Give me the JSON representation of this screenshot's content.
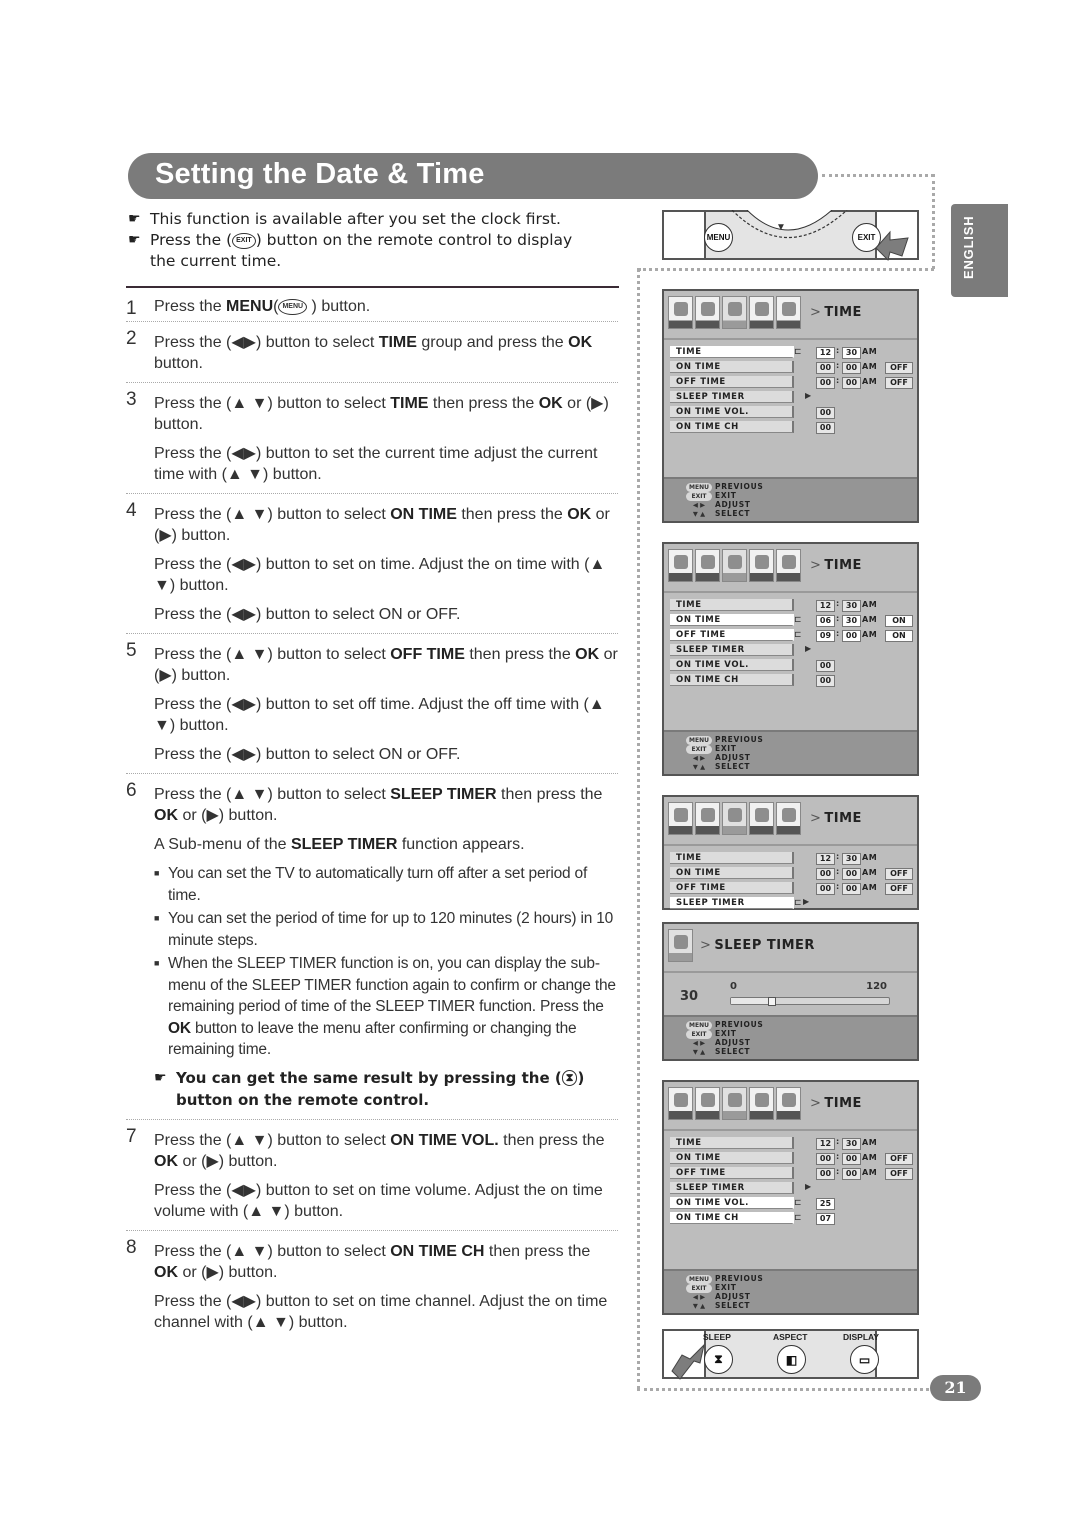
{
  "title": "Setting the Date & Time",
  "side_tab": "ENGLISH",
  "page_number": "21",
  "notes": [
    {
      "text": "This function is available after you set the clock first."
    },
    {
      "prefix": "Press the (",
      "icon": "EXIT",
      "suffix": ") button on the remote control to display",
      "line2": "the current time."
    }
  ],
  "steps": [
    {
      "num": "1",
      "paragraphs": [
        [
          {
            "t": "Press the "
          },
          {
            "b": "MENU"
          },
          {
            "t": "("
          },
          {
            "icon": "MENU"
          },
          {
            "t": " ) button."
          }
        ]
      ]
    },
    {
      "num": "2",
      "paragraphs": [
        [
          {
            "t": "Press the (◀▶) button to select "
          },
          {
            "b": "TIME"
          },
          {
            "t": " group and press the "
          },
          {
            "b": "OK"
          },
          {
            "t": " button."
          }
        ]
      ]
    },
    {
      "num": "3",
      "paragraphs": [
        [
          {
            "t": "Press the (▲ ▼) button to select "
          },
          {
            "b": "TIME"
          },
          {
            "t": " then press the "
          },
          {
            "b": "OK"
          },
          {
            "t": " or (▶) button."
          }
        ],
        [
          {
            "t": "Press the (◀▶) button to set the current time adjust the current time with (▲ ▼) button."
          }
        ]
      ]
    },
    {
      "num": "4",
      "paragraphs": [
        [
          {
            "t": "Press the (▲ ▼) button to select "
          },
          {
            "b": "ON TIME"
          },
          {
            "t": " then press the "
          },
          {
            "b": "OK"
          },
          {
            "t": " or (▶) button."
          }
        ],
        [
          {
            "t": "Press the (◀▶) button to set on time. Adjust the on time with (▲ ▼) button."
          }
        ],
        [
          {
            "t": "Press the (◀▶) button to select ON or OFF."
          }
        ]
      ]
    },
    {
      "num": "5",
      "paragraphs": [
        [
          {
            "t": "Press the (▲ ▼) button to select "
          },
          {
            "b": "OFF TIME"
          },
          {
            "t": " then press the "
          },
          {
            "b": "OK"
          },
          {
            "t": " or (▶) button."
          }
        ],
        [
          {
            "t": "Press the (◀▶) button to set off time. Adjust the off time with (▲ ▼) button."
          }
        ],
        [
          {
            "t": "Press the (◀▶) button to select ON or OFF."
          }
        ]
      ]
    },
    {
      "num": "6",
      "paragraphs": [
        [
          {
            "t": "Press the (▲ ▼) button to select "
          },
          {
            "b": "SLEEP TIMER"
          },
          {
            "t": " then press the "
          },
          {
            "b": "OK"
          },
          {
            "t": " or (▶) button."
          }
        ],
        [
          {
            "t": "A Sub-menu of the "
          },
          {
            "b": "SLEEP TIMER"
          },
          {
            "t": " function appears."
          }
        ]
      ],
      "bullets": [
        [
          {
            "t": "You can set the TV to automatically turn off after a set period of time."
          }
        ],
        [
          {
            "t": "You can set the period of time for up to 120 minutes (2 hours) in 10 minute steps."
          }
        ],
        [
          {
            "t": "When the SLEEP TIMER function is on, you can display the sub-menu of the SLEEP TIMER function again to confirm or change the remaining period of time of the SLEEP TIMER function. Press the "
          },
          {
            "b": "OK"
          },
          {
            "t": " button to leave the menu after confirming or changing the remaining time."
          }
        ]
      ],
      "tip": {
        "prefix": "You can get the same result by pressing the (",
        "icon": "SLEEP",
        "suffix": ") button on the remote control."
      }
    },
    {
      "num": "7",
      "paragraphs": [
        [
          {
            "t": "Press the (▲ ▼) button to select "
          },
          {
            "b": "ON TIME VOL."
          },
          {
            "t": " then press the "
          },
          {
            "b": "OK"
          },
          {
            "t": " or (▶) button."
          }
        ],
        [
          {
            "t": "Press the (◀▶) button to set on time volume. Adjust the on time volume with (▲ ▼) button."
          }
        ]
      ]
    },
    {
      "num": "8",
      "paragraphs": [
        [
          {
            "t": "Press the (▲ ▼) button to select "
          },
          {
            "b": "ON TIME CH"
          },
          {
            "t": " then press the "
          },
          {
            "b": "OK"
          },
          {
            "t": " or (▶) button."
          }
        ],
        [
          {
            "t": "Press the (◀▶) button to set on time channel. Adjust the on time channel with (▲ ▼) button."
          }
        ]
      ]
    }
  ],
  "remote_top": {
    "menu": "MENU",
    "exit": "EXIT",
    "center": "▼"
  },
  "remote_bottom": {
    "buttons": [
      {
        "label": "SLEEP",
        "glyph": "⧗"
      },
      {
        "label": "ASPECT",
        "glyph": "◧"
      },
      {
        "label": "DISPLAY",
        "glyph": "▭"
      }
    ]
  },
  "osd_footer": [
    {
      "key": "MENU",
      "text": "PREVIOUS"
    },
    {
      "key": "EXIT",
      "text": "EXIT"
    },
    {
      "key": "◀ ▶",
      "text": "ADJUST"
    },
    {
      "key": "▼ ▲",
      "text": "SELECT"
    }
  ],
  "osd_screens": [
    {
      "title": "TIME",
      "highlight": [
        0
      ],
      "rows": [
        {
          "label": "TIME",
          "h": "12",
          "m": "30",
          "ampm": "AM",
          "state": null,
          "edit": true
        },
        {
          "label": "ON TIME",
          "h": "00",
          "m": "00",
          "ampm": "AM",
          "state": "OFF"
        },
        {
          "label": "OFF TIME",
          "h": "00",
          "m": "00",
          "ampm": "AM",
          "state": "OFF"
        },
        {
          "label": "SLEEP TIMER",
          "arrow": true
        },
        {
          "label": "ON TIME VOL.",
          "value": "00"
        },
        {
          "label": "ON TIME CH",
          "value": "00"
        }
      ]
    },
    {
      "title": "TIME",
      "highlight": [
        1,
        2
      ],
      "rows": [
        {
          "label": "TIME",
          "h": "12",
          "m": "30",
          "ampm": "AM",
          "state": null
        },
        {
          "label": "ON TIME",
          "h": "06",
          "m": "30",
          "ampm": "AM",
          "state": "ON",
          "edit": true
        },
        {
          "label": "OFF TIME",
          "h": "09",
          "m": "00",
          "ampm": "AM",
          "state": "ON",
          "edit": true
        },
        {
          "label": "SLEEP TIMER",
          "arrow": true
        },
        {
          "label": "ON TIME VOL.",
          "value": "00"
        },
        {
          "label": "ON TIME CH",
          "value": "00"
        }
      ]
    },
    {
      "title": "TIME",
      "highlight": [
        3
      ],
      "rows": [
        {
          "label": "TIME",
          "h": "12",
          "m": "30",
          "ampm": "AM",
          "state": null
        },
        {
          "label": "ON TIME",
          "h": "00",
          "m": "00",
          "ampm": "AM",
          "state": "OFF"
        },
        {
          "label": "OFF TIME",
          "h": "00",
          "m": "00",
          "ampm": "AM",
          "state": "OFF"
        },
        {
          "label": "SLEEP TIMER",
          "arrow": true,
          "edit": true
        }
      ]
    },
    {
      "title": "TIME",
      "highlight": [
        4,
        5
      ],
      "rows": [
        {
          "label": "TIME",
          "h": "12",
          "m": "30",
          "ampm": "AM",
          "state": null
        },
        {
          "label": "ON TIME",
          "h": "00",
          "m": "00",
          "ampm": "AM",
          "state": "OFF"
        },
        {
          "label": "OFF TIME",
          "h": "00",
          "m": "00",
          "ampm": "AM",
          "state": "OFF"
        },
        {
          "label": "SLEEP TIMER",
          "arrow": true
        },
        {
          "label": "ON TIME VOL.",
          "value": "25",
          "edit": true
        },
        {
          "label": "ON TIME CH",
          "value": "07",
          "edit": true
        }
      ]
    }
  ],
  "sleep_timer": {
    "title": "SLEEP TIMER",
    "value": "30",
    "min": "0",
    "max": "120",
    "fraction": 0.25
  }
}
